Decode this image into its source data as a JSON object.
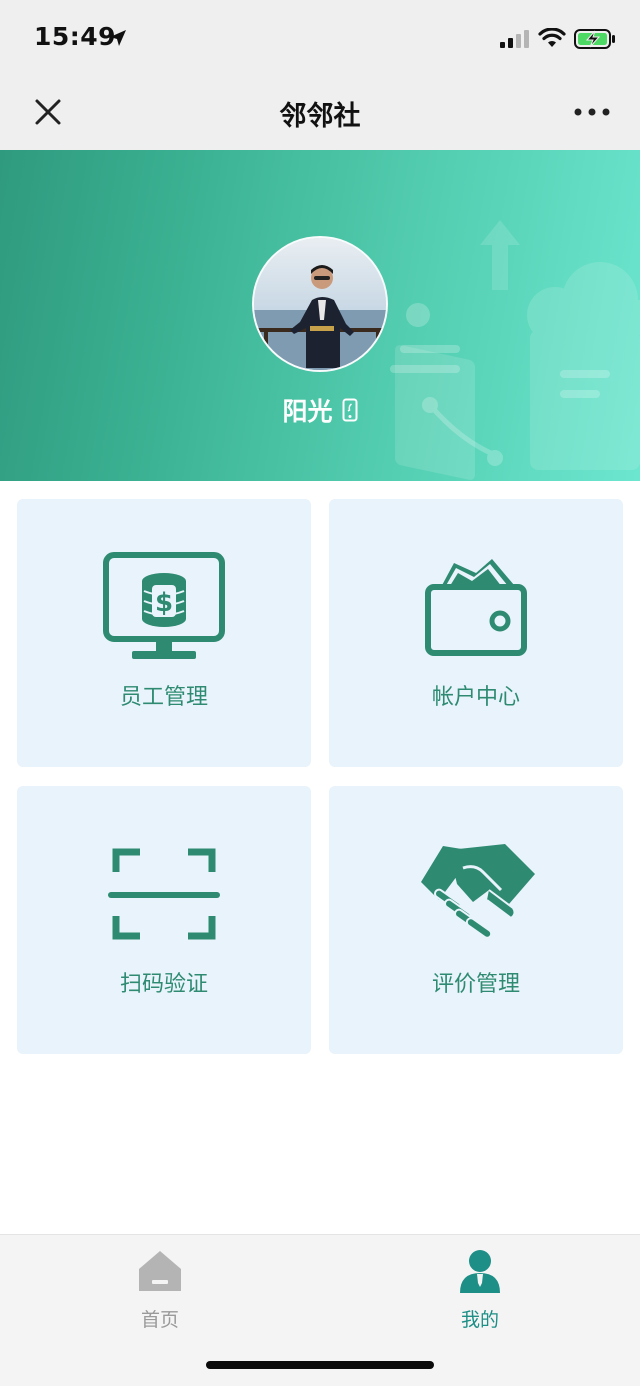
{
  "status_bar": {
    "time": "15:49",
    "location_icon": "location-arrow-icon",
    "signal_icon": "cellular-signal-icon",
    "wifi_icon": "wifi-icon",
    "battery_icon": "battery-charging-icon"
  },
  "nav": {
    "title": "邻邻社",
    "close_icon": "close-icon",
    "more_icon": "more-options-icon"
  },
  "profile": {
    "name": "阳光",
    "phone_icon": "phone-icon",
    "avatar": "avatar"
  },
  "menu": {
    "items": [
      {
        "label": "员工管理",
        "icon": "monitor-coins-icon"
      },
      {
        "label": "帐户中心",
        "icon": "wallet-icon"
      },
      {
        "label": "扫码验证",
        "icon": "scan-icon"
      },
      {
        "label": "评价管理",
        "icon": "handshake-icon"
      }
    ]
  },
  "tabbar": {
    "items": [
      {
        "label": "首页",
        "icon": "home-icon",
        "active": false
      },
      {
        "label": "我的",
        "icon": "user-icon",
        "active": true
      }
    ]
  },
  "colors": {
    "accent": "#2e8b72",
    "tile_bg": "#e9f3fb",
    "tab_active": "#2e8b72",
    "tab_inactive": "#9a9a9a",
    "banner_start": "#2f9a7e",
    "banner_end": "#6ce6cf"
  }
}
